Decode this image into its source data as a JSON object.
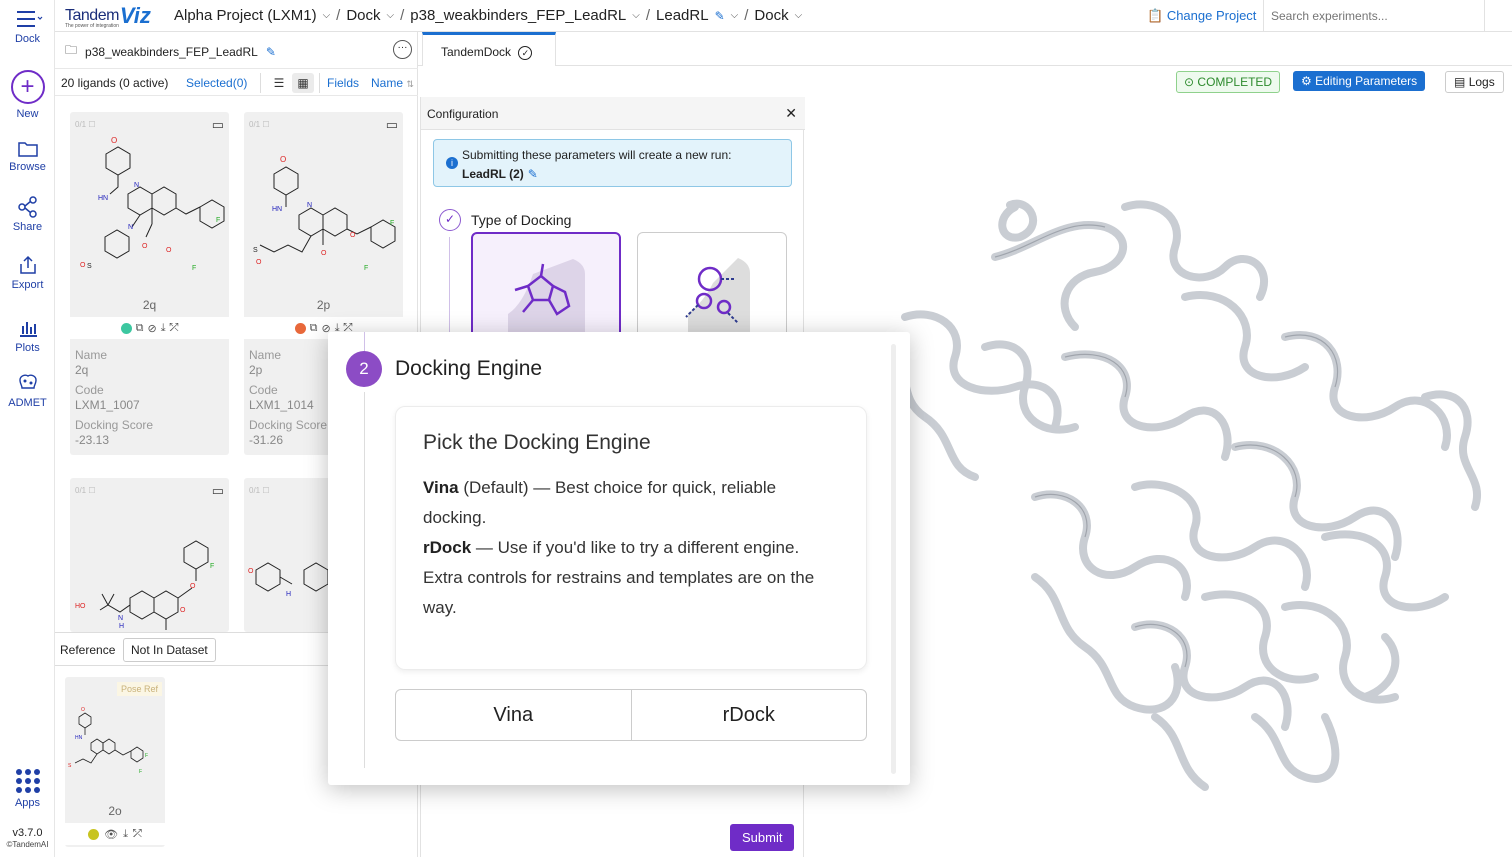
{
  "rail": {
    "dock_label": "Dock",
    "new_label": "New",
    "browse_label": "Browse",
    "share_label": "Share",
    "export_label": "Export",
    "plots_label": "Plots",
    "admet_label": "ADMET",
    "apps_label": "Apps",
    "version": "v3.7.0",
    "copyright": "©TandemAI"
  },
  "topbar": {
    "logo_text_1": "Tandem",
    "logo_text_2": "Viz",
    "logo_tagline": "The power of integration",
    "project": "Alpha Project (LXM1)",
    "crumb_1": "Dock",
    "crumb_2": "p38_weakbinders_FEP_LeadRL",
    "crumb_3": "LeadRL",
    "crumb_4": "Dock",
    "change_project": "Change Project",
    "search_placeholder": "Search experiments..."
  },
  "left_panel": {
    "folder_name": "p38_weakbinders_FEP_LeadRL",
    "ligand_count": "20 ligands (0 active)",
    "selected": "Selected(0)",
    "fields": "Fields",
    "sort": "Name",
    "cards": [
      {
        "id": "2q",
        "name_label": "Name",
        "name": "2q",
        "code_label": "Code",
        "code": "LXM1_1007",
        "score_label": "Docking Score",
        "score": "-23.13",
        "status_color": "#3cc7a0"
      },
      {
        "id": "2p",
        "name_label": "Name",
        "name": "2p",
        "code_label": "Code",
        "code": "LXM1_1014",
        "score_label": "Docking Score",
        "score": "-31.26",
        "status_color": "#e8683a"
      }
    ],
    "reference_label": "Reference",
    "not_in_dataset": "Not In Dataset",
    "ref_badge": "Pose Ref",
    "ref_id": "2o",
    "ref_status_color": "#c8c420"
  },
  "tabs": {
    "active": "TandemDock"
  },
  "status": {
    "completed": "COMPLETED",
    "editing": "Editing Parameters",
    "logs": "Logs"
  },
  "config": {
    "title": "Configuration",
    "info_line1": "Submitting these parameters will create a new run:",
    "info_line2": "LeadRL (2)",
    "step1_title": "Type of Docking",
    "submit": "Submit"
  },
  "modal": {
    "step_number": "2",
    "title": "Docking Engine",
    "tip_heading": "Pick the Docking Engine",
    "vina_name": "Vina",
    "vina_desc": " (Default) — Best choice for quick, reliable docking.",
    "rdock_name": "rDock",
    "rdock_desc": " — Use if you'd like to try a different engine. Extra controls for restrains and templates are on the way.",
    "option_vina": "Vina",
    "option_rdock": "rDock"
  }
}
